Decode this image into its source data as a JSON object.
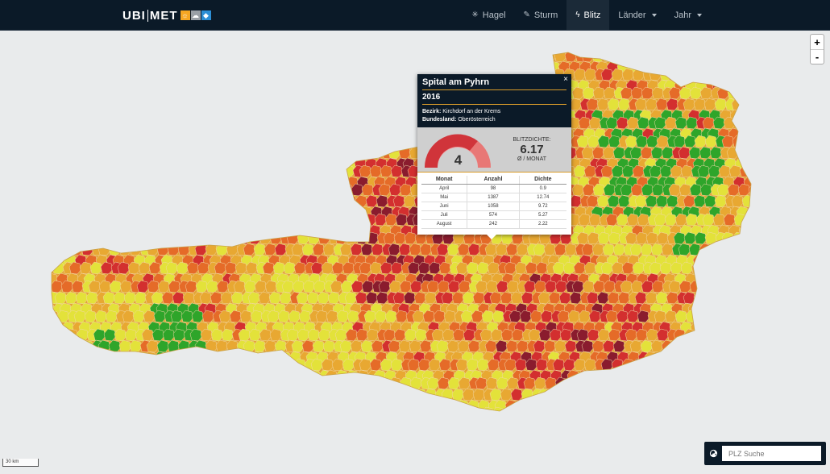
{
  "header": {
    "logo_bold_a": "UBI",
    "logo_bold_b": "MET",
    "logo_icons": [
      {
        "name": "sun-icon",
        "color": "#f5a623",
        "glyph": "☼"
      },
      {
        "name": "cloud-icon",
        "color": "#9aa0a6",
        "glyph": "☁"
      },
      {
        "name": "drop-icon",
        "color": "#2d8fd5",
        "glyph": "💧"
      }
    ],
    "nav": [
      {
        "label": "Hagel",
        "icon": "snowflake-icon",
        "glyph": "✳",
        "active": false,
        "dropdown": false
      },
      {
        "label": "Sturm",
        "icon": "wind-icon",
        "glyph": "✎",
        "active": false,
        "dropdown": false
      },
      {
        "label": "Blitz",
        "icon": "lightning-icon",
        "glyph": "ϟ",
        "active": true,
        "dropdown": false
      },
      {
        "label": "Länder",
        "icon": "",
        "glyph": "",
        "active": false,
        "dropdown": true
      },
      {
        "label": "Jahr",
        "icon": "",
        "glyph": "",
        "active": false,
        "dropdown": true
      }
    ]
  },
  "zoom": {
    "in": "+",
    "out": "-"
  },
  "popup": {
    "title": "Spital am Pyhrn",
    "year": "2016",
    "bezirk_label": "Bezirk:",
    "bezirk": "Kirchdorf an der Krems",
    "bundesland_label": "Bundesland:",
    "bundesland": "Oberösterreich",
    "close": "×",
    "gauge_value": "4",
    "dichte_label": "BLITZDICHTE:",
    "dichte_value": "6.17",
    "dichte_unit": "Ø / MONAT",
    "table": {
      "headers": [
        "Monat",
        "Anzahl",
        "Dichte"
      ],
      "rows": [
        [
          "April",
          "98",
          "0.9"
        ],
        [
          "Mai",
          "1387",
          "12.74"
        ],
        [
          "Juni",
          "1058",
          "9.72"
        ],
        [
          "Juli",
          "574",
          "5.27"
        ],
        [
          "August",
          "242",
          "2.22"
        ]
      ]
    }
  },
  "scale_label": "30 km",
  "search": {
    "placeholder": "PLZ Suche"
  },
  "colors": {
    "navbar": "#0b1a28",
    "accent": "#d89b2a",
    "level_green": "#2ea52a",
    "level_yellow": "#e3e23a",
    "level_orange_light": "#e8a832",
    "level_orange": "#e56b28",
    "level_red": "#d32f2f",
    "level_dark_red": "#8a1c2e"
  }
}
